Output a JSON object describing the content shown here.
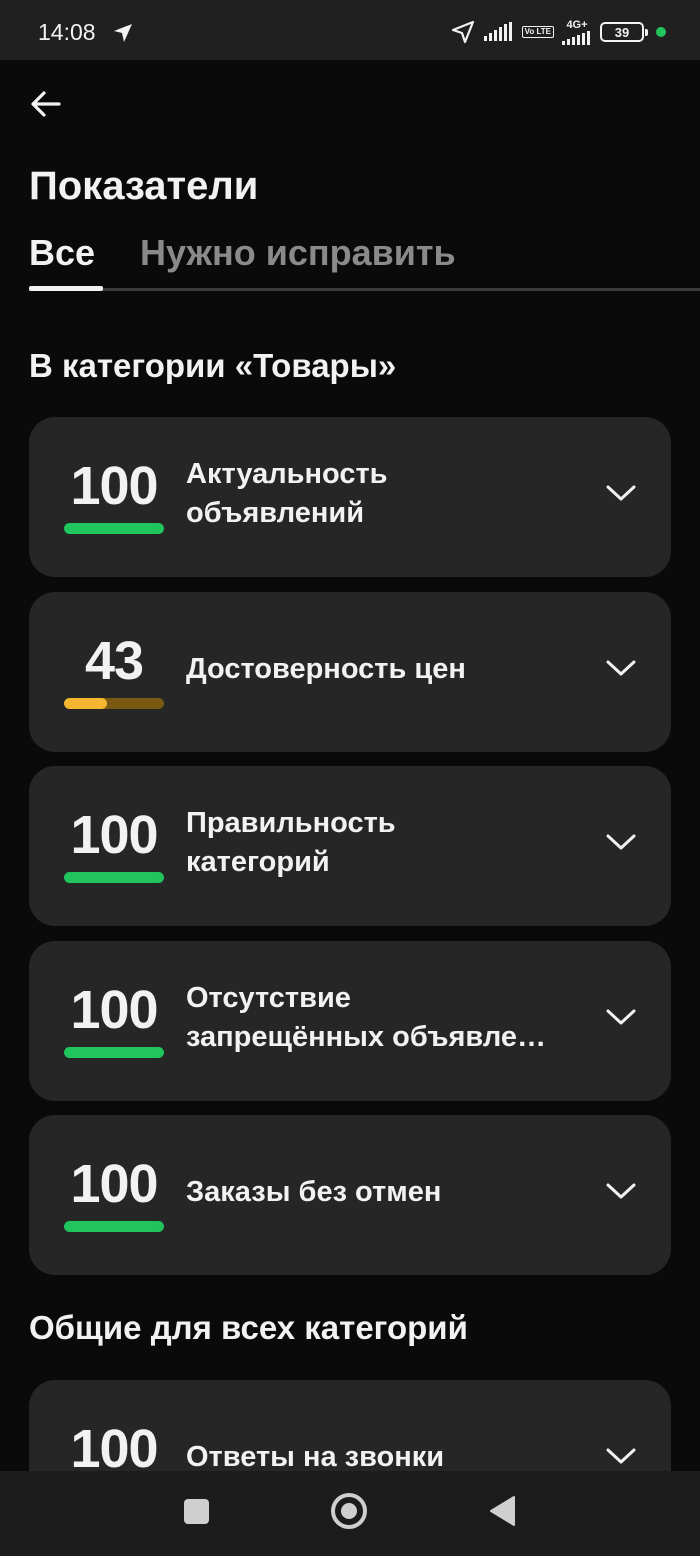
{
  "status_bar": {
    "time": "14:08",
    "volte": "Vo LTE",
    "network": "4G+",
    "battery": "39",
    "icons": [
      "location-arrow-icon",
      "navigation-icon",
      "signal-icon",
      "volte-icon",
      "signal-4g-icon",
      "battery-icon",
      "dot-icon"
    ]
  },
  "header": {
    "back_icon": "arrow-left-icon",
    "title": "Показатели"
  },
  "tabs": [
    {
      "label": "Все",
      "active": true
    },
    {
      "label": "Нужно исправить",
      "active": false
    }
  ],
  "sections": [
    {
      "title": "В категории «Товары»",
      "items": [
        {
          "score": "100",
          "score_fraction": 1.0,
          "line1": "Актуальность",
          "line2": "объявлений",
          "status_color": "#21c55d"
        },
        {
          "score": "43",
          "score_fraction": 0.43,
          "line1": "Достоверность цен",
          "line2": "",
          "status_color": "#f5b731"
        },
        {
          "score": "100",
          "score_fraction": 1.0,
          "line1": "Правильность",
          "line2": "категорий",
          "status_color": "#21c55d"
        },
        {
          "score": "100",
          "score_fraction": 1.0,
          "line1": "Отсутствие",
          "line2": "запрещённых объявле…",
          "status_color": "#21c55d"
        },
        {
          "score": "100",
          "score_fraction": 1.0,
          "line1": "Заказы без отмен",
          "line2": "",
          "status_color": "#21c55d"
        }
      ]
    },
    {
      "title": "Общие для всех категорий",
      "items": [
        {
          "score": "100",
          "score_fraction": 1.0,
          "line1": "Ответы на звонки",
          "line2": "",
          "status_color": "#21c55d"
        }
      ]
    }
  ],
  "nav": {
    "icons": [
      "recents-square-icon",
      "home-circle-icon",
      "back-triangle-icon"
    ]
  },
  "colors": {
    "background": "#0a0a0a",
    "card": "#262626",
    "good": "#21c55d",
    "warning": "#f5b731",
    "warning_track": "#7a5a13"
  }
}
